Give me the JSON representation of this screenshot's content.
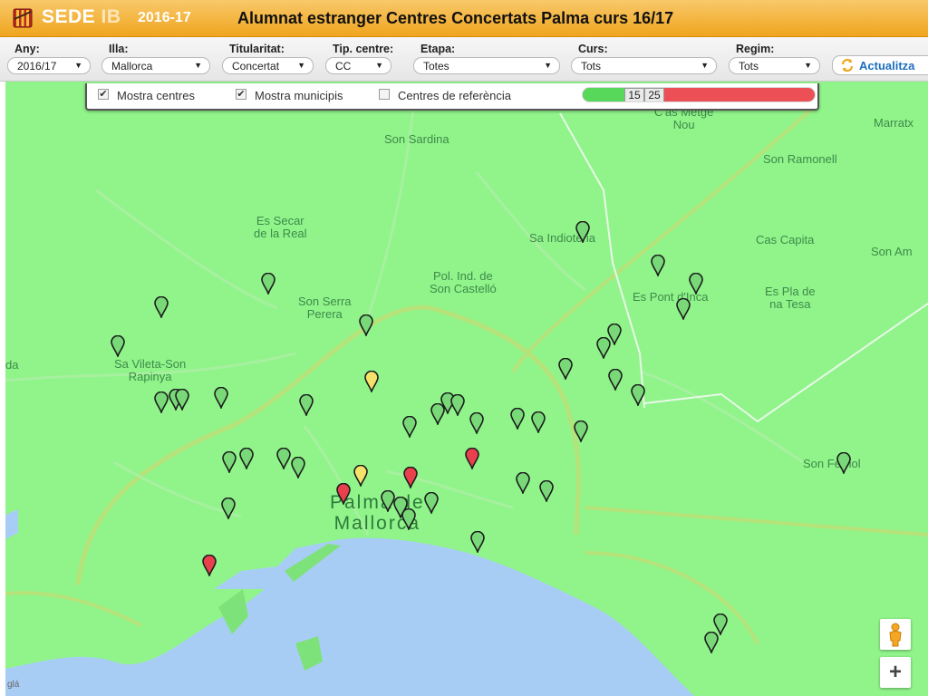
{
  "header": {
    "brand_sede": "SEDE",
    "brand_ib": "IB",
    "year": "2016-17",
    "title": "Alumnat estranger Centres Concertats Palma curs 16/17",
    "brand_color": "#f0a51e"
  },
  "filters": [
    {
      "name": "filter-any",
      "label": "Any:",
      "value": "2016/17"
    },
    {
      "name": "filter-illa",
      "label": "Illa:",
      "value": "Mallorca"
    },
    {
      "name": "filter-titularitat",
      "label": "Titularitat:",
      "value": "Concertat"
    },
    {
      "name": "filter-tip-centre",
      "label": "Tip. centre:",
      "value": "CC"
    },
    {
      "name": "filter-etapa",
      "label": "Etapa:",
      "value": "Totes"
    },
    {
      "name": "filter-curs",
      "label": "Curs:",
      "value": "Tots"
    },
    {
      "name": "filter-regim",
      "label": "Regim:",
      "value": "Tots"
    }
  ],
  "refresh": {
    "label": "Actualitza",
    "icon": "refresh-icon"
  },
  "controls": {
    "checks": [
      {
        "label": "Mostra centres",
        "checked": true
      },
      {
        "label": "Mostra municipis",
        "checked": true
      },
      {
        "label": "Centres de referència",
        "checked": false
      }
    ],
    "slider": {
      "low": "15",
      "high": "25",
      "low_color": "#57d85a",
      "high_color": "#ec4f56"
    }
  },
  "map": {
    "land_color": "#90f48a",
    "sea_color": "#a8cdf5",
    "places": [
      {
        "text": "Son Sardina"
      },
      {
        "text": "Sa Indioteria"
      },
      {
        "text": "Son Ramonell"
      },
      {
        "text": "Cas Capita"
      },
      {
        "text": "Son Am"
      },
      {
        "text": "Es Secar\nde la Real"
      },
      {
        "text": "Pol. Ind. de\nSon Castelló"
      },
      {
        "text": "Son Serra\nPerera"
      },
      {
        "text": "Es Pont d'Inca"
      },
      {
        "text": "Es Pla de\nna Tesa"
      },
      {
        "text": "Sa Vileta-Son\nRapinya"
      },
      {
        "text": "Son Ferriol"
      },
      {
        "text": "Marratx"
      },
      {
        "text": "C'as Metge\nNou"
      },
      {
        "text": "da"
      },
      {
        "text": "Palma de\nMallorca"
      }
    ],
    "marker_colors": {
      "green": "#79d979",
      "yellow": "#f5e26a",
      "red": "#e8414d"
    },
    "pegman_icon": "pegman-icon",
    "zoom_in_label": "+",
    "attribution": "glá"
  }
}
